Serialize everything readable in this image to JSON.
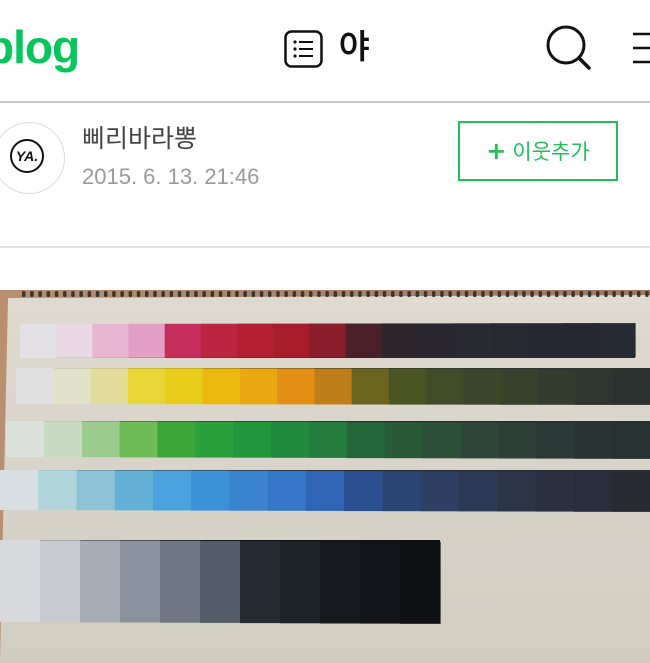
{
  "header": {
    "logo_text": "blog",
    "title": "야",
    "icons": {
      "list": "list-icon",
      "search": "search-icon",
      "menu": "menu-icon"
    },
    "colors": {
      "brand": "#03c75a"
    }
  },
  "author": {
    "avatar_text": "YA.",
    "name": "삐리바라뽕",
    "date": "2015. 6. 13. 21:46",
    "neighbor_button": {
      "plus": "+",
      "label": "이웃추가"
    }
  },
  "photo": {
    "strips": [
      {
        "name": "red",
        "colors": [
          "#e4e1e6",
          "#e8d9e4",
          "#e6b5cf",
          "#e4a0c4",
          "#c52d5c",
          "#bb2540",
          "#b41f33",
          "#a81c2c",
          "#8c1d2a",
          "#4a2128",
          "#2d262d",
          "#2a2730",
          "#292a32",
          "#282a31",
          "#262933",
          "#262933",
          "#252a33"
        ]
      },
      {
        "name": "yellow",
        "colors": [
          "#dfe0df",
          "#e2e1c9",
          "#e2dc9b",
          "#e8d536",
          "#eacd1a",
          "#ebb80f",
          "#e9a712",
          "#e38f15",
          "#c07e18",
          "#6b6420",
          "#4a5523",
          "#414d28",
          "#3c462b",
          "#36422c",
          "#323b2e",
          "#2f362f",
          "#2c3230"
        ]
      },
      {
        "name": "green",
        "colors": [
          "#dde1db",
          "#c7dcc0",
          "#9ccb8f",
          "#6dbc55",
          "#3ca53a",
          "#2ba03a",
          "#22963d",
          "#21893e",
          "#237b3e",
          "#22663a",
          "#2a5938",
          "#2e4f38",
          "#2e4638",
          "#2c3f37",
          "#2a3936",
          "#293534",
          "#283233"
        ]
      },
      {
        "name": "blue",
        "colors": [
          "#d7dfe3",
          "#b2d4dc",
          "#8dc2d5",
          "#64b1d8",
          "#4ba2dc",
          "#3d91d6",
          "#3a84d0",
          "#3577c8",
          "#2f65b4",
          "#2b4f8f",
          "#2c4575",
          "#2d3f62",
          "#2d3a55",
          "#2c3548",
          "#2b3140",
          "#2a2e3a",
          "#292b34"
        ]
      },
      {
        "name": "gray",
        "colors": [
          "#d8d9dc",
          "#c8cbd1",
          "#a7adb5",
          "#8a929d",
          "#6f7884",
          "#535c68",
          "#262a32",
          "#1d2128",
          "#16191e",
          "#121419",
          "#0f1115"
        ]
      }
    ]
  }
}
